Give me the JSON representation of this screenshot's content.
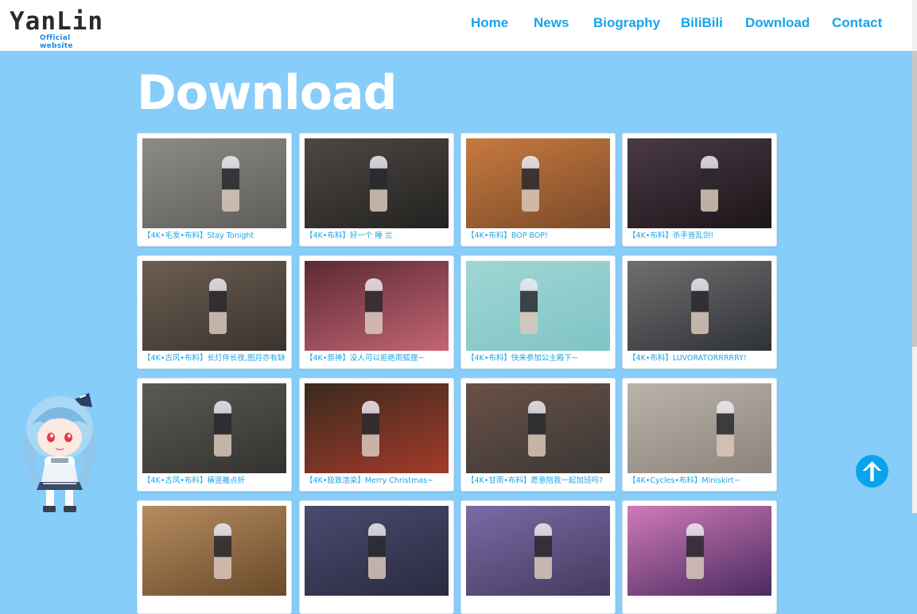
{
  "header": {
    "logo_main": "YanLin",
    "logo_sub": "Official website",
    "nav": [
      "Home",
      "News",
      "Biography",
      "BiliBili",
      "Download",
      "Contact"
    ]
  },
  "page_title": "Download",
  "colors": {
    "page_bg": "#87cdf9",
    "nav_link": "#1aa3e8",
    "caption": "#20a3e6",
    "back_top": "#0aa4ec"
  },
  "cards": [
    {
      "caption": "【4K•毛发•布料】Stay Tonight",
      "colors": [
        "#8d8b88",
        "#5f5d5a"
      ]
    },
    {
      "caption": "【4K•布料】好一个 睡 兰",
      "colors": [
        "#4b4845",
        "#242220"
      ]
    },
    {
      "caption": "【4K•布料】BOP BOP!",
      "colors": [
        "#c77a3e",
        "#7a4a2a"
      ]
    },
    {
      "caption": "【4K•布料】杀手皆乱剑!",
      "colors": [
        "#4a3a44",
        "#1c1519"
      ]
    },
    {
      "caption": "【4K•古风•布料】长灯伴长夜,图月亦有缺",
      "colors": [
        "#6c5e52",
        "#3a332d"
      ]
    },
    {
      "caption": "【4K•原神】没人可以拒绝雨狐狸~",
      "colors": [
        "#5b2a33",
        "#c46474"
      ]
    },
    {
      "caption": "【4K•布料】快来参加公主殿下~",
      "colors": [
        "#9fd6d4",
        "#7fc4c6"
      ]
    },
    {
      "caption": "【4K•布料】LUVORATORRRRRY!",
      "colors": [
        "#6f6f70",
        "#2f3236"
      ]
    },
    {
      "caption": "【4K•古风•布料】橫竖撇点折",
      "colors": [
        "#5a5a55",
        "#34322f"
      ]
    },
    {
      "caption": "【4K•极致渲染】Merry Christmas~",
      "colors": [
        "#3a2a1e",
        "#a33a2a"
      ]
    },
    {
      "caption": "【4K•甘雨•布料】愿意陪我一起加班吗?",
      "colors": [
        "#6a5146",
        "#3b3836"
      ]
    },
    {
      "caption": "【4K•Cycles•布料】Miniskirt~",
      "colors": [
        "#b9b3aa",
        "#8c847a"
      ]
    },
    {
      "caption": "",
      "colors": [
        "#b58c5f",
        "#6a4a2a"
      ]
    },
    {
      "caption": "",
      "colors": [
        "#4a4a70",
        "#2a2a40"
      ]
    },
    {
      "caption": "",
      "colors": [
        "#7c6aa6",
        "#433a5e"
      ]
    },
    {
      "caption": "",
      "colors": [
        "#d07ab8",
        "#4a2a60"
      ]
    }
  ]
}
